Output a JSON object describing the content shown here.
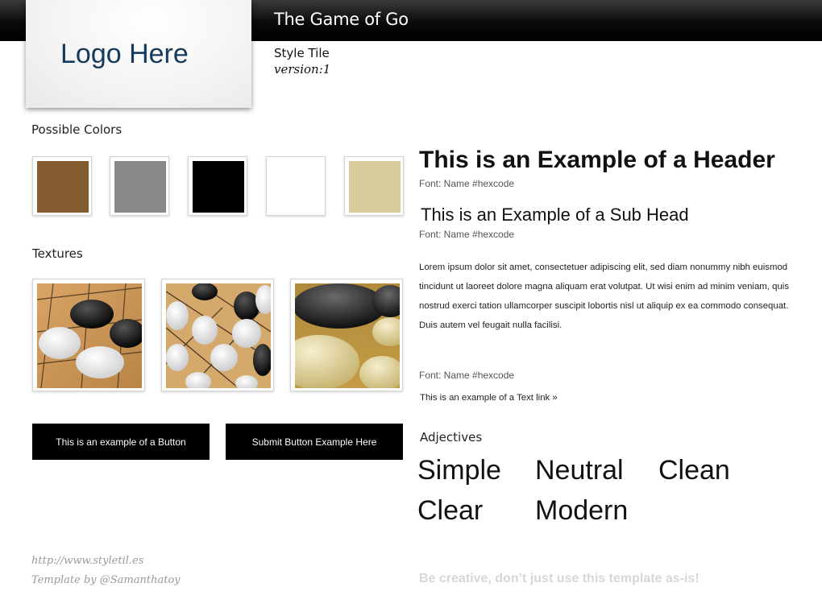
{
  "header": {
    "title": "The Game of Go"
  },
  "logo": {
    "text": "Logo Here"
  },
  "tile": {
    "label": "Style Tile",
    "version": "version:1"
  },
  "colors": {
    "label": "Possible Colors",
    "swatches": [
      "#835c2f",
      "#888888",
      "#000000",
      "#ffffff",
      "#d8cc9c"
    ]
  },
  "textures": {
    "label": "Textures",
    "items": [
      "go-stones-on-board",
      "go-stones-grid",
      "go-stones-closeup"
    ]
  },
  "buttons": {
    "primary": "This is an example of a Button",
    "submit": "Submit Button Example Here"
  },
  "typography": {
    "header": "This is an Example of a Header",
    "header_note": "Font: Name #hexcode",
    "subhead": "This is an Example of a Sub Head",
    "subhead_note": "Font: Name #hexcode",
    "body": "Lorem ipsum dolor sit amet, consectetuer adipiscing elit, sed diam nonummy nibh euismod tincidunt ut laoreet dolore magna aliquam erat volutpat. Ut wisi enim ad minim veniam, quis nostrud exerci tation ullamcorper suscipit lobortis nisl ut aliquip ex ea commodo consequat. Duis autem vel feugait nulla facilisi.",
    "link_note": "Font: Name #hexcode",
    "link": "This is an example of a Text link »"
  },
  "adjectives": {
    "label": "Adjectives",
    "words": [
      "Simple",
      "Neutral",
      "Clean",
      "Clear",
      "Modern"
    ]
  },
  "footer": {
    "url": "http://www.styletil.es",
    "credit": "Template by @Samanthatoy",
    "tagline": "Be creative, don’t just use this template as-is!"
  }
}
